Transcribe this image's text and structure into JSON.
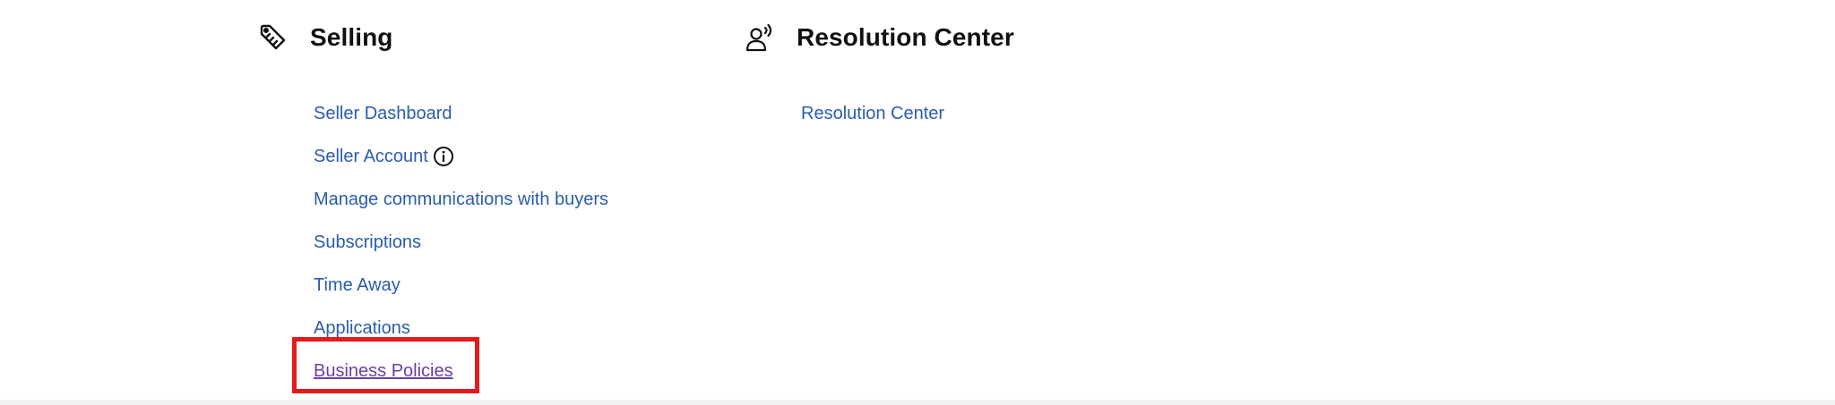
{
  "selling": {
    "icon": "tag-icon",
    "title": "Selling",
    "links": [
      {
        "label": "Seller Dashboard"
      },
      {
        "label": "Seller Account",
        "info_icon": "info-icon"
      },
      {
        "label": "Manage communications with buyers"
      },
      {
        "label": "Subscriptions"
      },
      {
        "label": "Time Away"
      },
      {
        "label": "Applications"
      },
      {
        "label": "Business Policies",
        "state": "visited"
      }
    ]
  },
  "resolution_center": {
    "icon": "person-speaking-icon",
    "title": "Resolution Center",
    "links": [
      {
        "label": "Resolution Center"
      }
    ]
  },
  "highlight": {
    "target": "Business Policies",
    "color": "#e31b1b"
  },
  "colors": {
    "link": "#2a5cad",
    "link_visited": "#6b3fa0",
    "heading": "#111111"
  }
}
